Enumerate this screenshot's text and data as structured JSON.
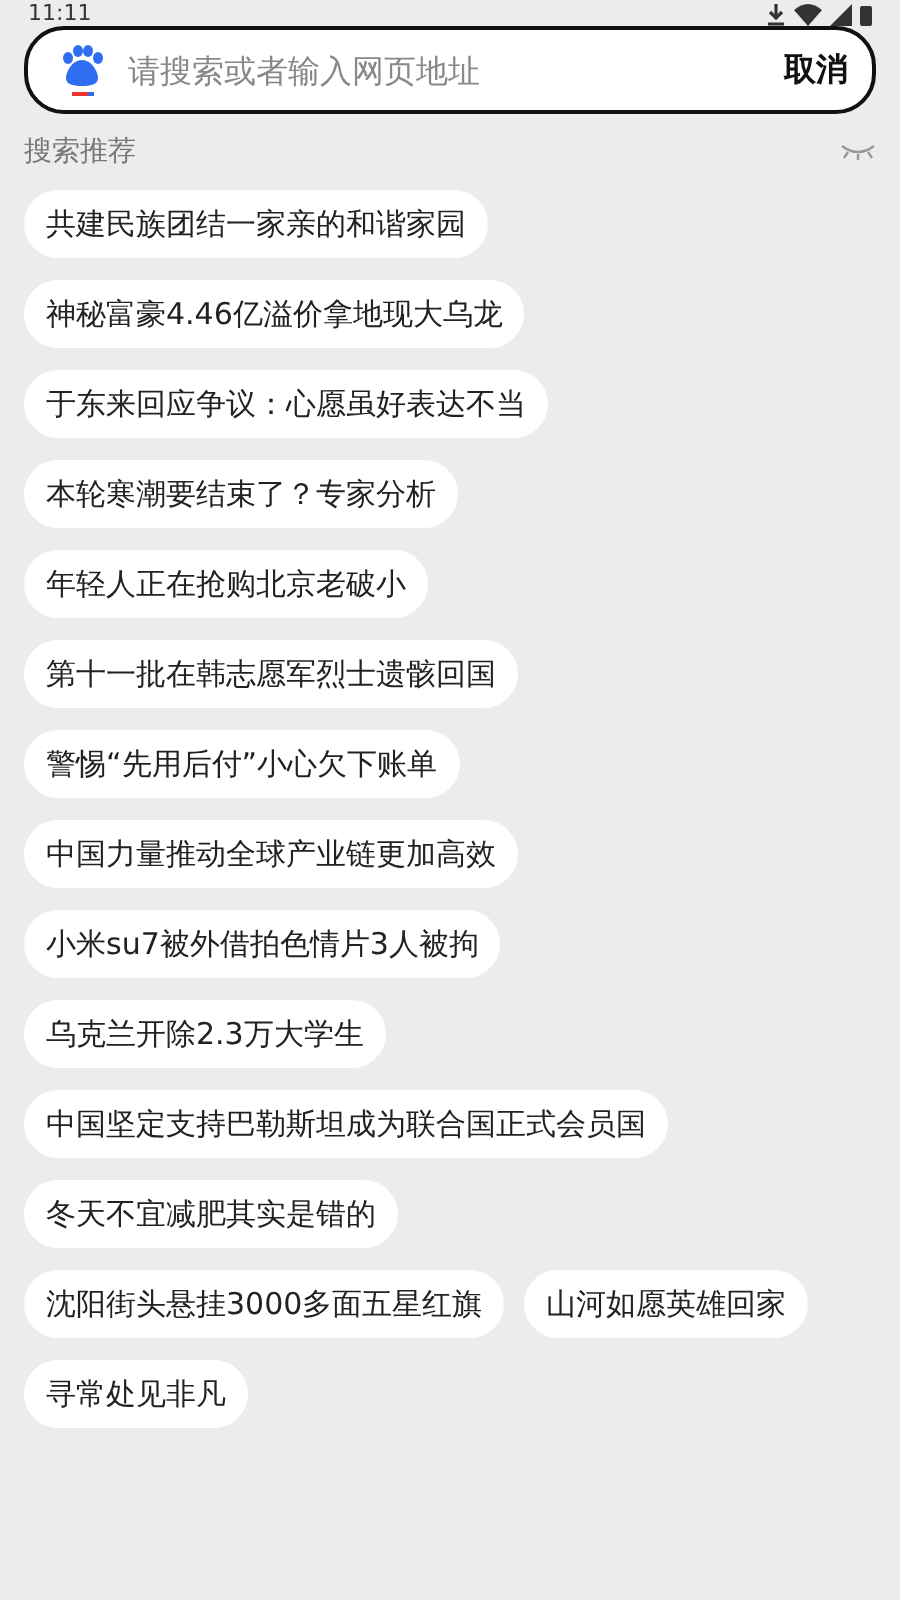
{
  "status_bar": {
    "time": "11:11"
  },
  "search": {
    "placeholder": "请搜索或者输入网页地址",
    "cancel": "取消"
  },
  "suggestions": {
    "title": "搜索推荐",
    "items": [
      "共建民族团结一家亲的和谐家园",
      "神秘富豪4.46亿溢价拿地现大乌龙",
      "于东来回应争议：心愿虽好表达不当",
      "本轮寒潮要结束了？专家分析",
      "年轻人正在抢购北京老破小",
      "第十一批在韩志愿军烈士遗骸回国",
      "警惕“先用后付”小心欠下账单",
      "中国力量推动全球产业链更加高效",
      "小米su7被外借拍色情片3人被拘",
      "乌克兰开除2.3万大学生",
      "中国坚定支持巴勒斯坦成为联合国正式会员国",
      "冬天不宜减肥其实是错的",
      "沈阳街头悬挂3000多面五星红旗",
      "山河如愿英雄回家",
      "寻常处见非凡"
    ]
  }
}
